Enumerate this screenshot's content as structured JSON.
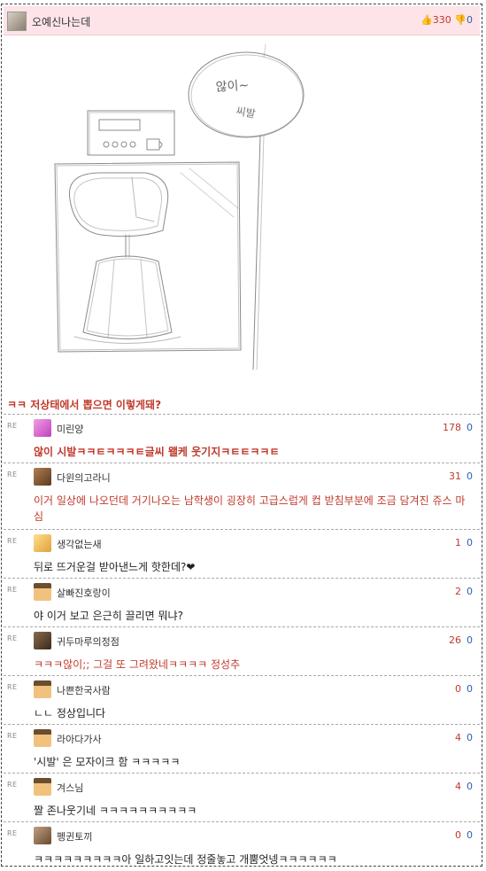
{
  "post": {
    "author": "오예신나는데",
    "upvotes": "330",
    "downvotes": "0",
    "sketch_text_1": "않이~",
    "sketch_text_2": "씨발",
    "title": "ㅋㅋ 저상태에서 뽑으면 이렇게돼?"
  },
  "re_label": "RE",
  "comments": [
    {
      "nick": "미린양",
      "up": "178",
      "down": "0",
      "text": "않이 시발ㅋㅋㅌㅋㅋㅋㅌ글씨 왤케 웃기지ㅋㅌㅌㅋㅋㅌ",
      "avatar": "pink"
    },
    {
      "nick": "다윈의고라니",
      "up": "31",
      "down": "0",
      "text": "이거 일상에 나오던데 거기나오는 남학생이 굉장히 고급스럽게 컵 받침부분에 조금 담겨진 쥬스 마심",
      "avatar": "brown"
    },
    {
      "nick": "생각없는새",
      "up": "1",
      "down": "0",
      "text": "뒤로 뜨거운걸 받아낸느게 핫한데?❤",
      "avatar": "yellow"
    },
    {
      "nick": "살빠진호랑이",
      "up": "2",
      "down": "0",
      "text": "야 이거 보고 은근히 끌리면 뭐냐?",
      "avatar": "block"
    },
    {
      "nick": "귀두마루의정점",
      "up": "26",
      "down": "0",
      "text": "ㅋㅋㅋ않이;; 그걸 또 그려왔네ㅋㅋㅋㅋ 정성추",
      "avatar": "dark"
    },
    {
      "nick": "나쁜한국사람",
      "up": "0",
      "down": "0",
      "text": "ㄴㄴ 정상입니다",
      "avatar": "block"
    },
    {
      "nick": "라아다가사",
      "up": "4",
      "down": "0",
      "text": "'시발' 은 모자이크 함 ㅋㅋㅋㅋㅋ",
      "avatar": "block"
    },
    {
      "nick": "겨스님",
      "up": "4",
      "down": "0",
      "text": "짤 존나웃기네 ㅋㅋㅋㅋㅋㅋㅋㅋㅋㅋ",
      "avatar": "block"
    },
    {
      "nick": "펭귄토끼",
      "up": "0",
      "down": "0",
      "text": "ㅋㅋㅋㅋㅋㅋㅋㅋㅋ아 일하고잇는데 정줄놓고 개뿜엇넹ㅋㅋㅋㅋㅋㅋ",
      "avatar": "bunny"
    }
  ],
  "colors": {
    "accent_red": "#c0392b",
    "header_pink": "#fce4e8",
    "down_blue": "#2b5fb0"
  }
}
